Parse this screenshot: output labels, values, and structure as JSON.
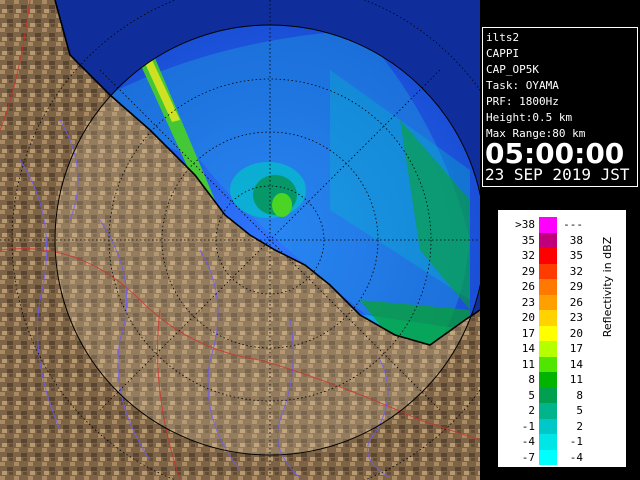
{
  "info": {
    "lines": [
      "ilts2",
      "CAPPI",
      "CAP_OP5K",
      "Task: OYAMA",
      "PRF: 1800Hz",
      "Height:0.5 km",
      "Max Range:80 km"
    ],
    "time": "05:00:00",
    "date": "23 SEP 2019 JST"
  },
  "legend": {
    "unit_label": "Reflectivity in dBZ",
    "bins": [
      {
        "lower": ">38",
        "upper": "---",
        "color": "#ff00ff"
      },
      {
        "lower": "35",
        "upper": "38",
        "color": "#c0007a"
      },
      {
        "lower": "32",
        "upper": "35",
        "color": "#ff0000"
      },
      {
        "lower": "29",
        "upper": "32",
        "color": "#ff3c00"
      },
      {
        "lower": "26",
        "upper": "29",
        "color": "#ff7800"
      },
      {
        "lower": "23",
        "upper": "26",
        "color": "#ffa000"
      },
      {
        "lower": "20",
        "upper": "23",
        "color": "#ffd200"
      },
      {
        "lower": "17",
        "upper": "20",
        "color": "#ffff00"
      },
      {
        "lower": "14",
        "upper": "17",
        "color": "#b4ff00"
      },
      {
        "lower": "11",
        "upper": "14",
        "color": "#50e600"
      },
      {
        "lower": "8",
        "upper": "11",
        "color": "#00b400"
      },
      {
        "lower": "5",
        "upper": "8",
        "color": "#00a050"
      },
      {
        "lower": "2",
        "upper": "5",
        "color": "#00b48c"
      },
      {
        "lower": "-1",
        "upper": "2",
        "color": "#00c8c8"
      },
      {
        "lower": "-4",
        "upper": "-1",
        "color": "#00e6e6"
      },
      {
        "lower": "-7",
        "upper": "-4",
        "color": "#00ffff"
      }
    ]
  },
  "colors": {
    "sea": "#1a4fd6",
    "land": "#8a6e4c",
    "range_ring": "#000000",
    "coastline": "#000000"
  }
}
